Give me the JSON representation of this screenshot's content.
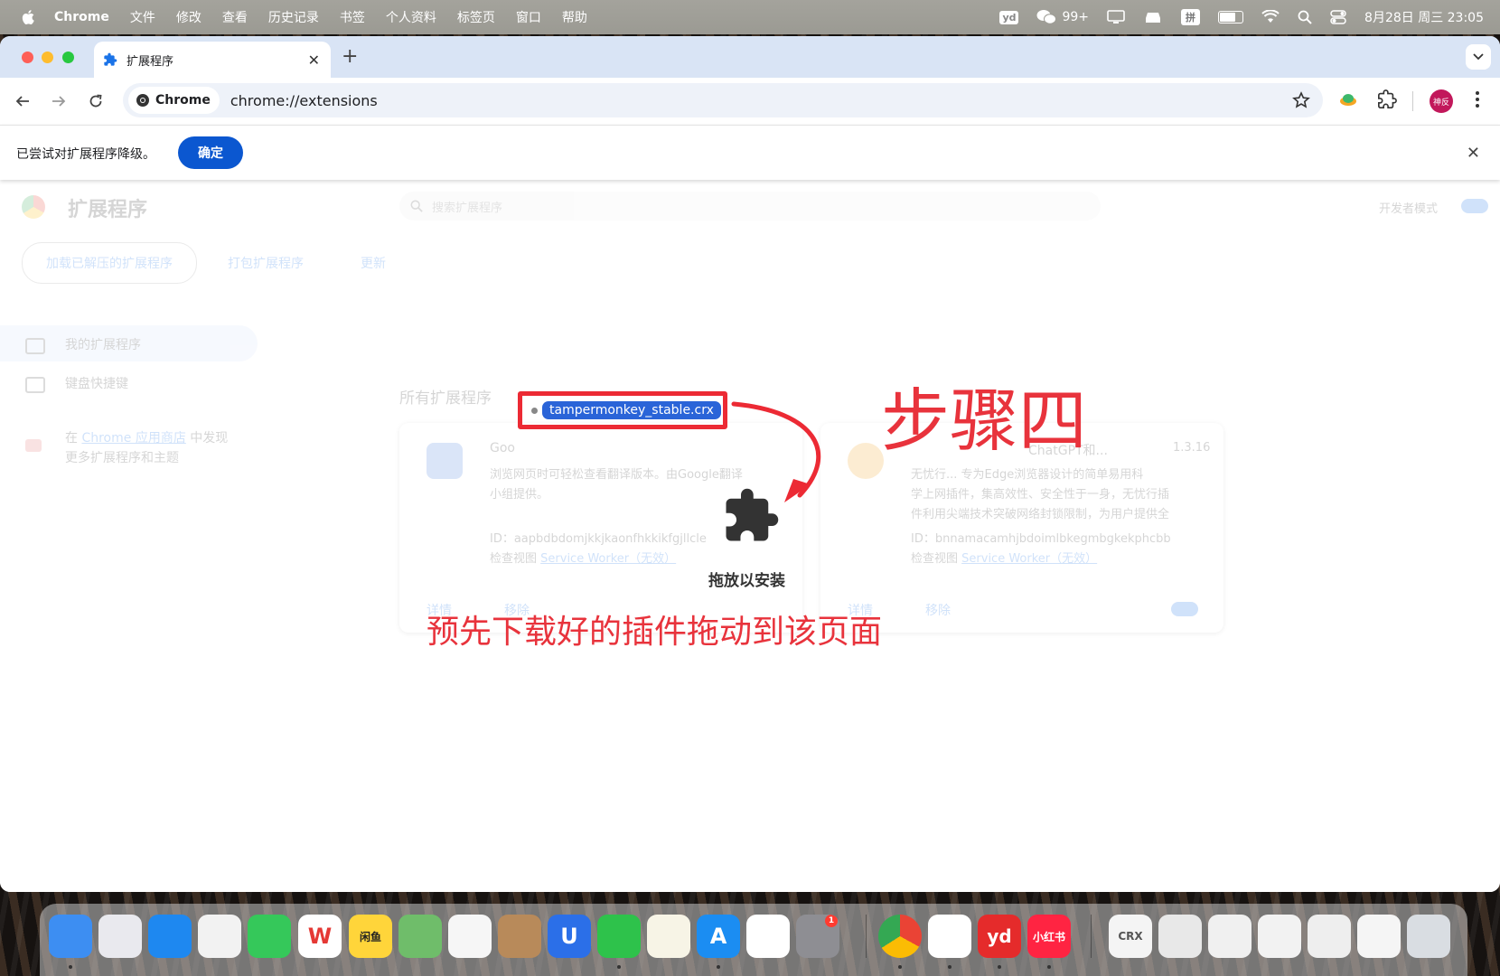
{
  "menubar": {
    "app_name": "Chrome",
    "menus": [
      "文件",
      "修改",
      "查看",
      "历史记录",
      "书签",
      "个人资料",
      "标签页",
      "窗口",
      "帮助"
    ],
    "status": {
      "yd_label": "yd",
      "wechat_count": "99+",
      "input_method": "拼",
      "datetime": "8月28日 周三 23:05"
    }
  },
  "browser": {
    "tab_title": "扩展程序",
    "new_tab_label": "+",
    "site_chip_label": "Chrome",
    "url": "chrome://extensions",
    "profile_label": "神反"
  },
  "infobar": {
    "message": "已尝试对扩展程序降级。",
    "ok_label": "确定"
  },
  "extensions_page": {
    "title": "扩展程序",
    "search_placeholder": "搜索扩展程序",
    "developer_mode_label": "开发者模式",
    "buttons": [
      "加载已解压的扩展程序",
      "打包扩展程序",
      "更新"
    ],
    "sidebar": {
      "my_extensions": "我的扩展程序",
      "keyboard_shortcuts": "键盘快捷键",
      "store_prefix": "在",
      "store_link": "Chrome 应用商店",
      "store_suffix": "中发现",
      "store_line2": "更多扩展程序和主题"
    },
    "all_extensions_heading": "所有扩展程序",
    "cards": [
      {
        "name": "Goo",
        "desc_line1": "浏览网页时可轻松查看翻译版本。由Google翻译",
        "desc_line2": "小组提供。",
        "id_line": "ID：aapbdbdomjkkjkaonfhkkikfgjllcle",
        "inspect_prefix": "检查视图",
        "inspect_link": "Service Worker（无效）",
        "details_label": "详情",
        "remove_label": "移除"
      },
      {
        "name": "ChatGPT和...",
        "version": "1.3.16",
        "desc_line1": "无忧行... 专为Edge浏览器设计的简单易用科",
        "desc_line2": "学上网插件，集高效性、安全性于一身，无忧行插",
        "desc_line3": "件利用尖端技术突破网络封锁限制，为用户提供全",
        "id_line": "ID：bnnamacamhjbdoimlbkegmbgkekphcbb",
        "inspect_prefix": "检查视图",
        "inspect_link": "Service Worker（无效）",
        "details_label": "详情",
        "remove_label": "移除"
      }
    ]
  },
  "overlay": {
    "dragged_file": "tampermonkey_stable.crx",
    "step_title": "步骤四",
    "drop_label": "拖放以安装",
    "instruction": "预先下载好的插件拖动到该页面"
  },
  "dock": {
    "apps": [
      {
        "name": "finder",
        "label": "",
        "color": "#3d8ef2"
      },
      {
        "name": "launchpad",
        "label": "",
        "color": "#e9e9ee"
      },
      {
        "name": "safari",
        "label": "",
        "color": "#1e88f0"
      },
      {
        "name": "quicktime",
        "label": "",
        "color": "#f2f2f2"
      },
      {
        "name": "messages",
        "label": "",
        "color": "#35c85a"
      },
      {
        "name": "wps",
        "label": "W",
        "color": "#ffffff"
      },
      {
        "name": "xianyu",
        "label": "闲鱼",
        "color": "#ffd53a"
      },
      {
        "name": "maps",
        "label": "",
        "color": "#6fbd6a"
      },
      {
        "name": "photos",
        "label": "",
        "color": "#f6f6f6"
      },
      {
        "name": "contacts",
        "label": "",
        "color": "#b88a5a"
      },
      {
        "name": "vpn",
        "label": "U",
        "color": "#2b6fe8"
      },
      {
        "name": "wechat",
        "label": "",
        "color": "#2ec24b"
      },
      {
        "name": "notes",
        "label": "",
        "color": "#f7f4e6"
      },
      {
        "name": "app-store",
        "label": "A",
        "color": "#1b8df2"
      },
      {
        "name": "baidu-netdisk",
        "label": "",
        "color": "#ffffff"
      },
      {
        "name": "system-settings",
        "label": "",
        "color": "#8e8e93",
        "badge": "1"
      },
      {
        "name": "chrome",
        "label": "",
        "color": "#ffffff"
      },
      {
        "name": "vector",
        "label": "",
        "color": "#ffffff"
      },
      {
        "name": "youdao",
        "label": "yd",
        "color": "#e52b2b"
      },
      {
        "name": "xiaohongshu",
        "label": "小红书",
        "color": "#ff2442"
      },
      {
        "name": "crx-file",
        "label": "CRX",
        "color": "#f4f4f4"
      },
      {
        "name": "recent-1",
        "label": "",
        "color": "#e8e8e8"
      },
      {
        "name": "recent-2",
        "label": "",
        "color": "#f0f0f0"
      },
      {
        "name": "recent-3",
        "label": "",
        "color": "#f2f2f2"
      },
      {
        "name": "recent-4",
        "label": "",
        "color": "#eeeeee"
      },
      {
        "name": "recent-5",
        "label": "",
        "color": "#f5f5f5"
      },
      {
        "name": "trash",
        "label": "",
        "color": "#d9dde2"
      }
    ]
  },
  "colors": {
    "accent_blue": "#0b57d0",
    "annotation_red": "#e8333c",
    "tab_strip": "#d9e4f5"
  }
}
